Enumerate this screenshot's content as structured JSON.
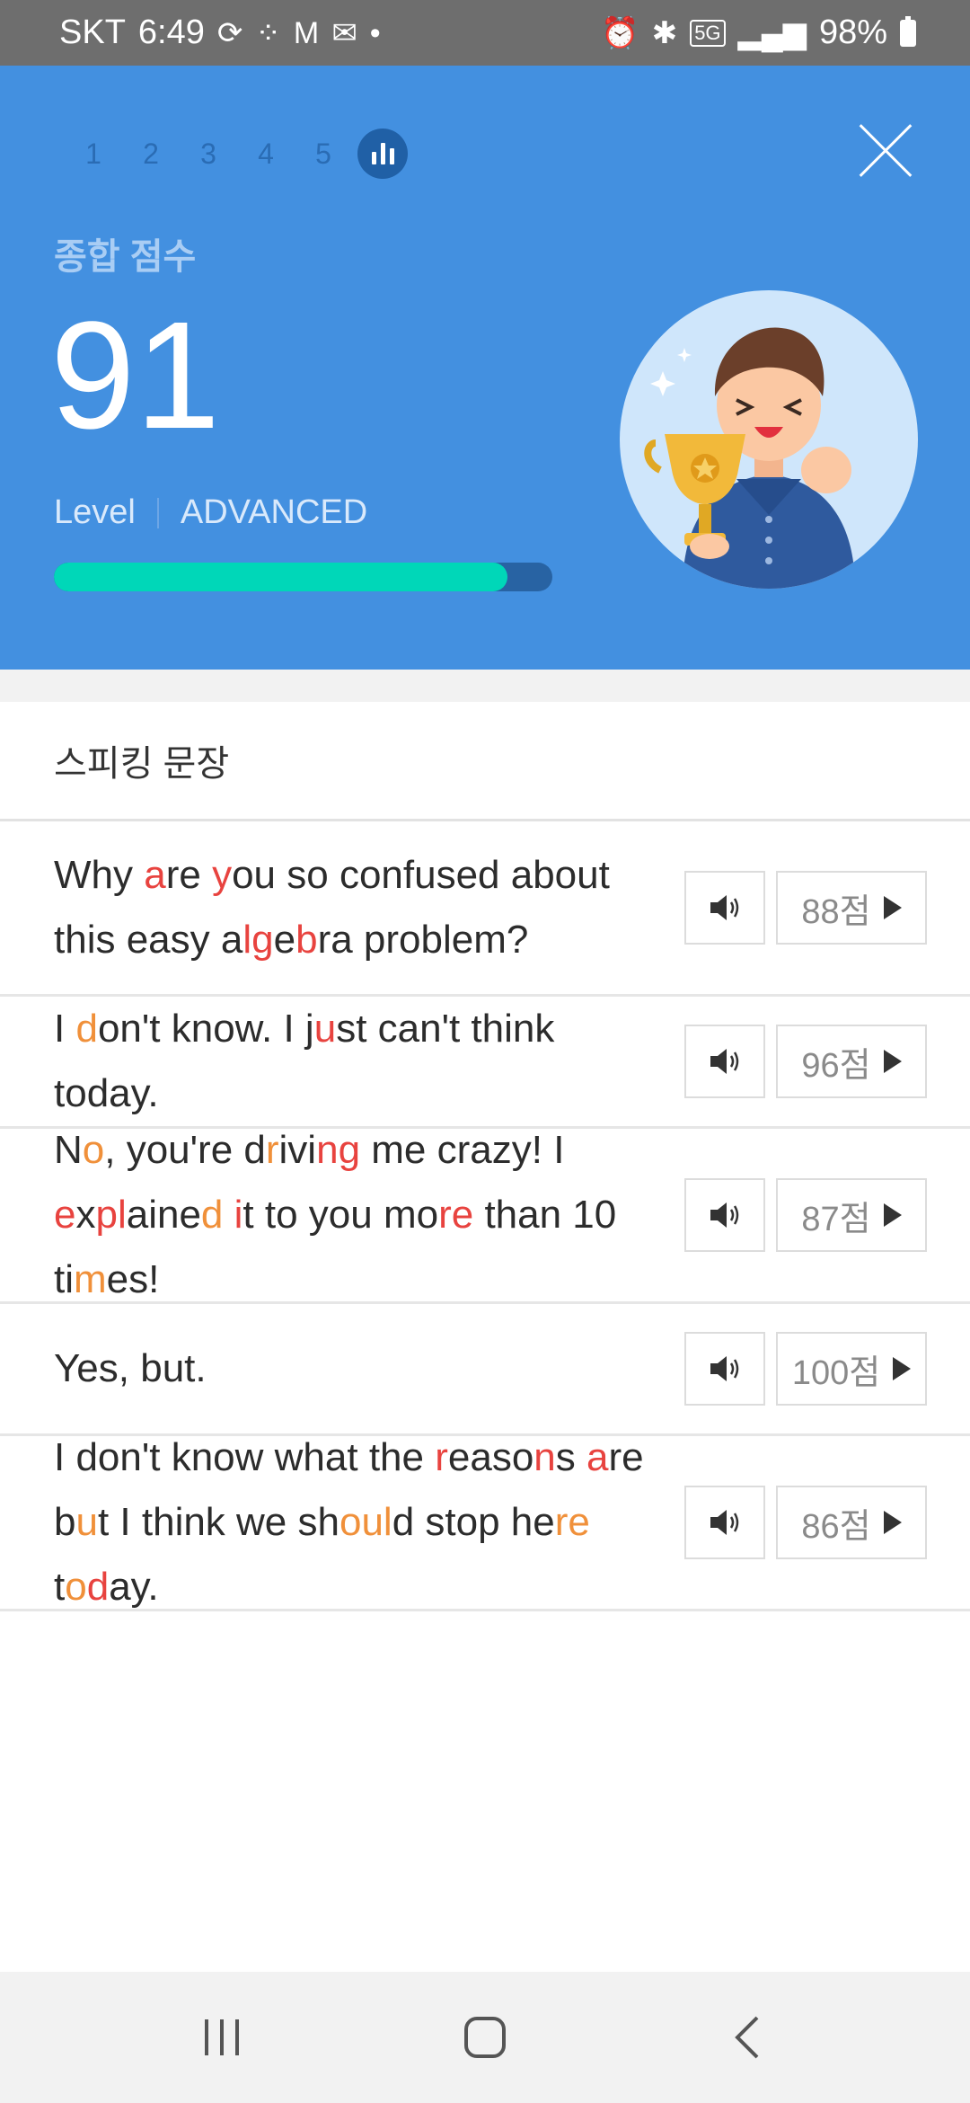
{
  "status_bar": {
    "carrier": "SKT",
    "time": "6:49",
    "network": "5G",
    "battery": "98%"
  },
  "header": {
    "steps": [
      "1",
      "2",
      "3",
      "4",
      "5"
    ],
    "score_label": "종합 점수",
    "score": "91",
    "level_label": "Level",
    "level_value": "ADVANCED",
    "progress_fraction": 0.91,
    "colors": {
      "background": "#4390e0",
      "progress": "#00d7b8",
      "progress_track": "#2863a3"
    }
  },
  "list": {
    "section_title": "스피킹 문장",
    "items": [
      {
        "text": "Why are you so confused about this easy algebra problem?",
        "score": "88점"
      },
      {
        "text": "I don't know. I just can't think today.",
        "score": "96점"
      },
      {
        "text": "No, you're driving me crazy! I explained it to you more than 10 times!",
        "score": "87점"
      },
      {
        "text": "Yes, but.",
        "score": "100점"
      },
      {
        "text": "I don't know what the reasons are but I think we should stop here today.",
        "score": "86점"
      }
    ],
    "highlight_colors": {
      "red": "#e8433f",
      "orange": "#f0903a"
    }
  },
  "nav": {
    "icons": [
      "recent-apps-icon",
      "home-icon",
      "back-icon"
    ]
  }
}
